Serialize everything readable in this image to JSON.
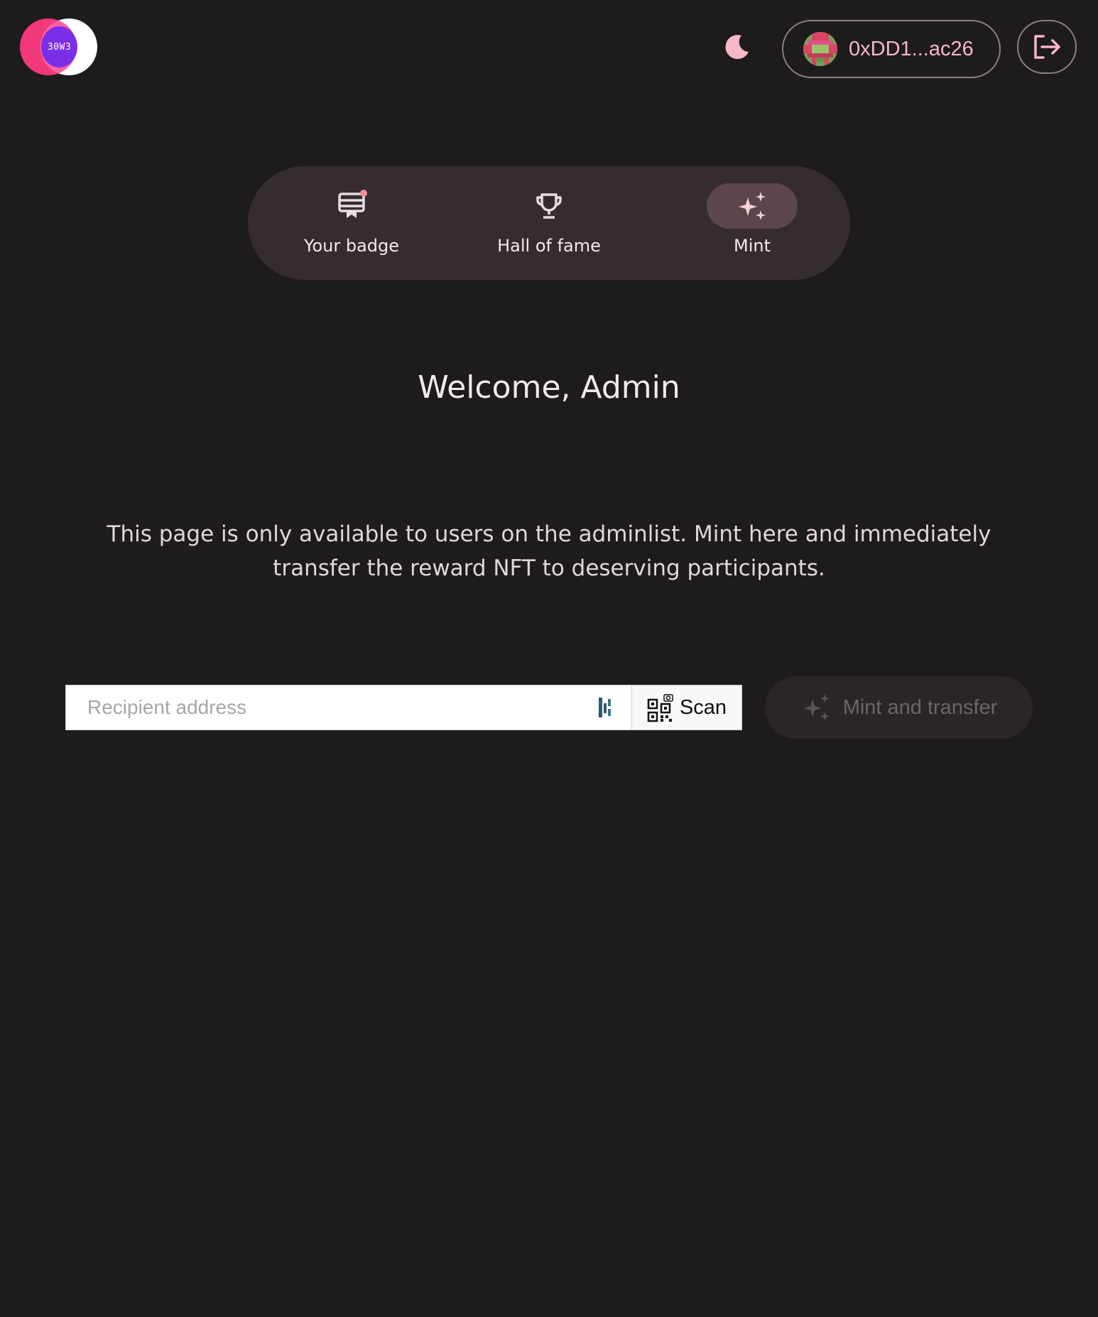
{
  "header": {
    "logo_text": "30W3",
    "wallet": {
      "address": "0xDD1...ac26"
    }
  },
  "nav": {
    "items": [
      {
        "label": "Your badge",
        "icon": "badge-icon",
        "active": false
      },
      {
        "label": "Hall of fame",
        "icon": "trophy-icon",
        "active": false
      },
      {
        "label": "Mint",
        "icon": "sparkles-icon",
        "active": true
      }
    ]
  },
  "main": {
    "title": "Welcome, Admin",
    "description": "This page is only available to users on the adminlist. Mint here and immediately transfer the reward NFT to deserving participants.",
    "recipient": {
      "placeholder": "Recipient address",
      "value": ""
    },
    "scan_label": "Scan",
    "mint_button_label": "Mint and transfer"
  },
  "colors": {
    "background": "#1e1b1c",
    "accent_pink": "#f6b8c8",
    "nav_bg": "#352c2f",
    "nav_active_bg": "#5c464c",
    "logo_pink": "#f0387a",
    "logo_purple": "#7b2ee8"
  }
}
